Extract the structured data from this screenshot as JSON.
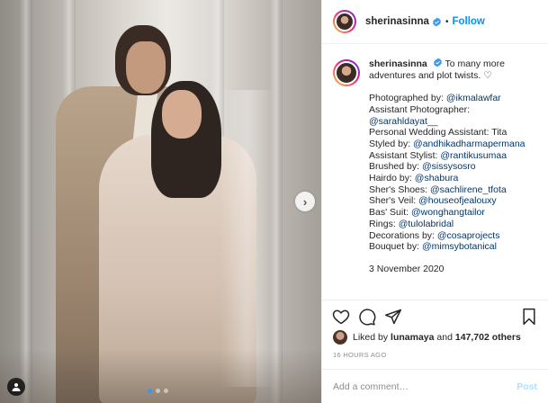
{
  "header": {
    "username": "sherinasinna",
    "follow_label": "Follow",
    "separator": "•"
  },
  "caption": {
    "username": "sherinasinna",
    "text_line1": "To many more",
    "text_line2": "adventures and plot twists. ♡",
    "credits": [
      {
        "label": "Photographed by: ",
        "mention": "@ikmalawfar"
      },
      {
        "label": "Assistant Photographer:",
        "mention": ""
      },
      {
        "label": "",
        "mention": "@sarahldayat__"
      },
      {
        "label": "Personal Wedding Assistant: Tita",
        "mention": ""
      },
      {
        "label": "Styled by: ",
        "mention": "@andhikadharmapermana"
      },
      {
        "label": "Assistant Stylist: ",
        "mention": "@rantikusumaa"
      },
      {
        "label": "Brushed by: ",
        "mention": "@sissysosro"
      },
      {
        "label": "Hairdo by: ",
        "mention": "@shabura"
      },
      {
        "label": "Sher's Shoes: ",
        "mention": "@sachlirene_tfota"
      },
      {
        "label": "Sher's Veil: ",
        "mention": "@houseofjealouxy"
      },
      {
        "label": "Bas' Suit: ",
        "mention": "@wonghangtailor"
      },
      {
        "label": "Rings: ",
        "mention": "@tulolabridal"
      },
      {
        "label": "Decorations by: ",
        "mention": "@cosaprojects"
      },
      {
        "label": "Bouquet by: ",
        "mention": "@mimsybotanical"
      }
    ],
    "date": "3 November 2020"
  },
  "likes": {
    "prefix": "Liked by ",
    "user": "lunamaya",
    "middle": " and ",
    "count": "147,702 others"
  },
  "timestamp": "16 HOURS AGO",
  "comment": {
    "placeholder": "Add a comment…",
    "post_label": "Post"
  },
  "carousel": {
    "slide_count": 3,
    "active_index": 0,
    "next_glyph": "›"
  },
  "colors": {
    "link_blue": "#0095f6",
    "mention": "#00376b",
    "verified": "#3897f0",
    "post_disabled": "#b2dffc"
  },
  "icons": [
    "verified-badge-icon",
    "heart-icon",
    "comment-icon",
    "share-icon",
    "bookmark-icon",
    "tag-user-icon",
    "chevron-right-icon"
  ]
}
